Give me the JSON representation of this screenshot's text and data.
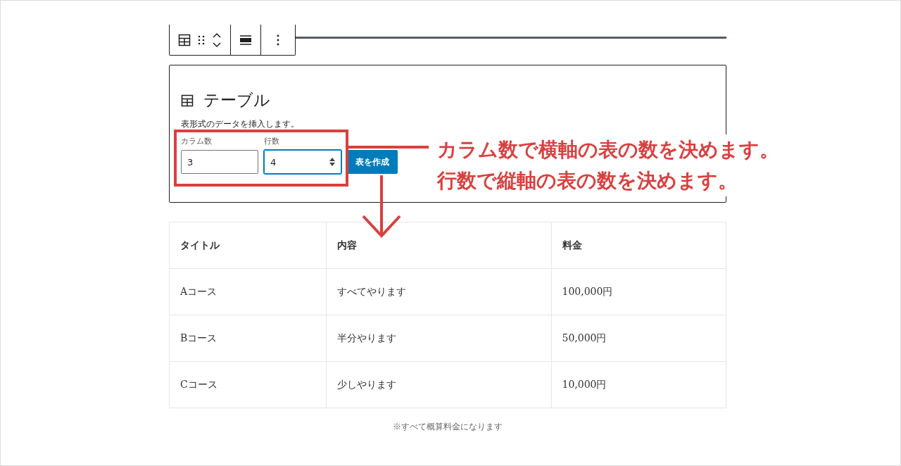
{
  "block": {
    "title": "テーブル",
    "description": "表形式のデータを挿入します。",
    "fields": [
      {
        "label": "カラム数",
        "value": "3"
      },
      {
        "label": "行数",
        "value": "4"
      }
    ],
    "button": "表を作成"
  },
  "annotation": {
    "lines": [
      "カラム数で横軸の表の数を決めます。",
      "行数で縦軸の表の数を決めます。"
    ]
  },
  "table": {
    "columns": [
      "タイトル",
      "内容",
      "料金"
    ],
    "rows": [
      [
        "Aコース",
        "すべてやります",
        "100,000円"
      ],
      [
        "Bコース",
        "半分やります",
        "50,000円"
      ],
      [
        "Cコース",
        "少しやります",
        "10,000円"
      ]
    ],
    "caption": "※すべて概算料金になります"
  }
}
